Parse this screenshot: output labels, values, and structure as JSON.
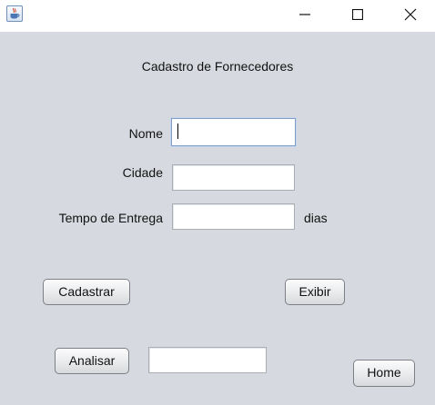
{
  "window": {
    "app_icon": "java-cup-icon",
    "controls": [
      "minimize-icon",
      "maximize-icon",
      "close-icon"
    ]
  },
  "form": {
    "title": "Cadastro de Fornecedores",
    "nome_label": "Nome",
    "nome_value": "",
    "cidade_label": "Cidade",
    "cidade_value": "",
    "tempo_label": "Tempo de Entrega",
    "tempo_value": "",
    "dias_label": "dias",
    "analisar_value": ""
  },
  "buttons": {
    "cadastrar": "Cadastrar",
    "exibir": "Exibir",
    "analisar": "Analisar",
    "home": "Home"
  }
}
